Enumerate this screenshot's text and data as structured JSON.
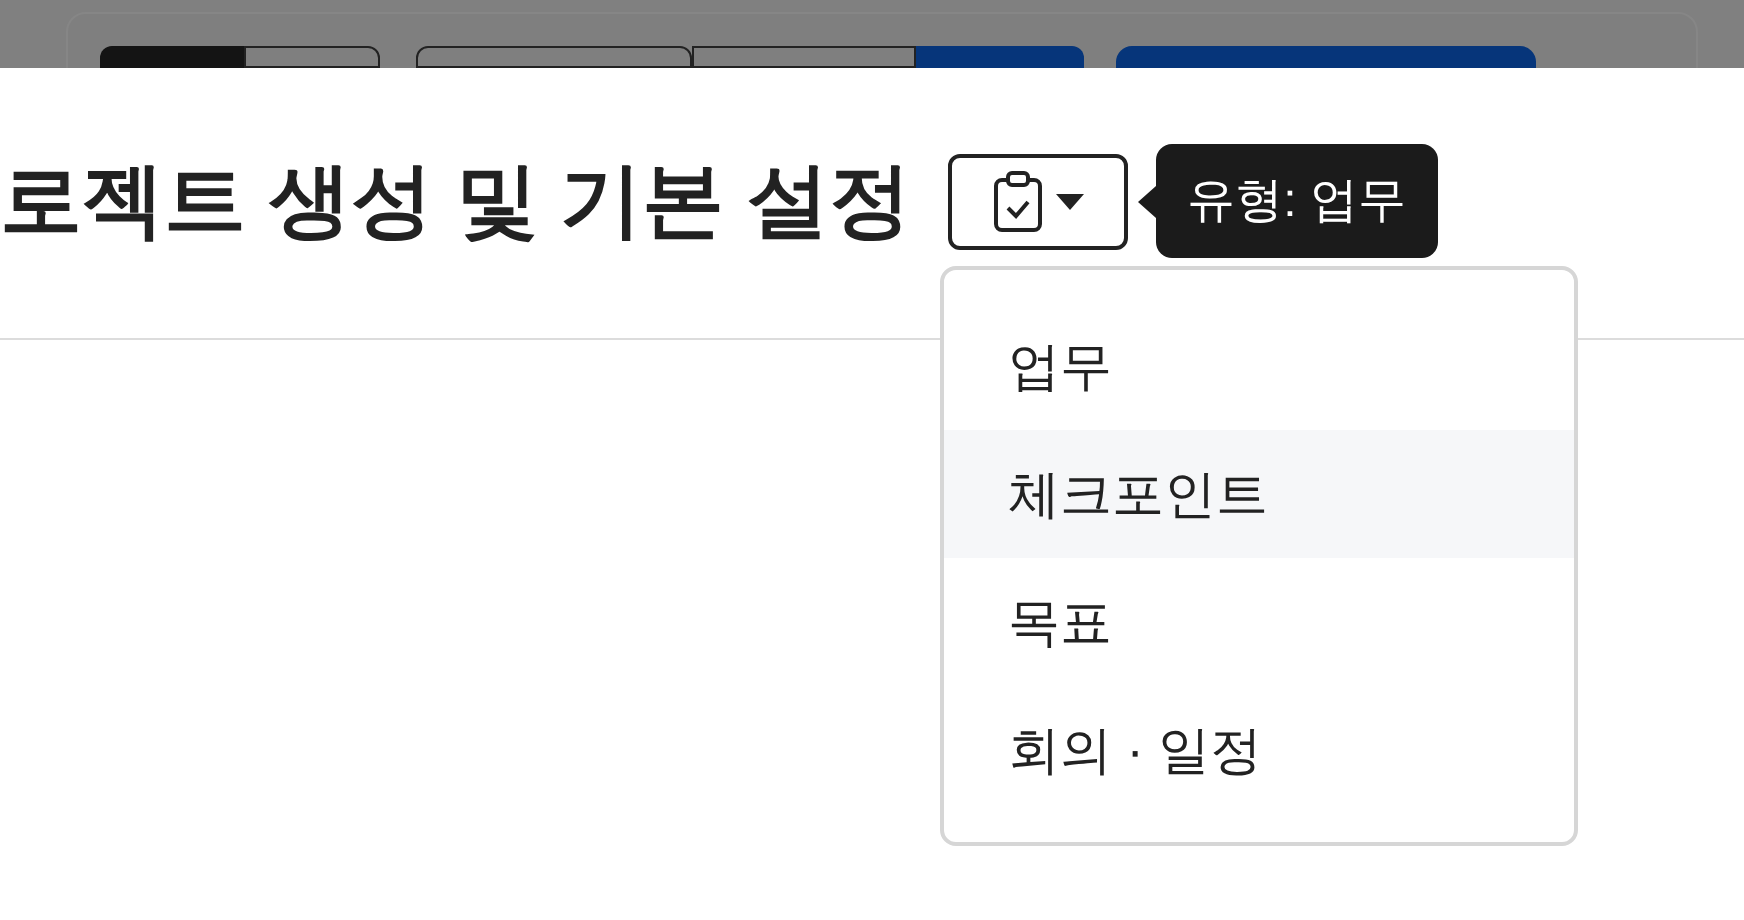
{
  "dialog": {
    "title": "로젝트 생성 및 기본 설정",
    "type_button": {
      "expanded": true
    },
    "tooltip": "유형: 업무"
  },
  "type_menu": {
    "items": [
      {
        "label": "업무",
        "highlighted": false
      },
      {
        "label": "체크포인트",
        "highlighted": true
      },
      {
        "label": "목표",
        "highlighted": false
      },
      {
        "label": "회의 · 일정",
        "highlighted": false
      }
    ]
  }
}
